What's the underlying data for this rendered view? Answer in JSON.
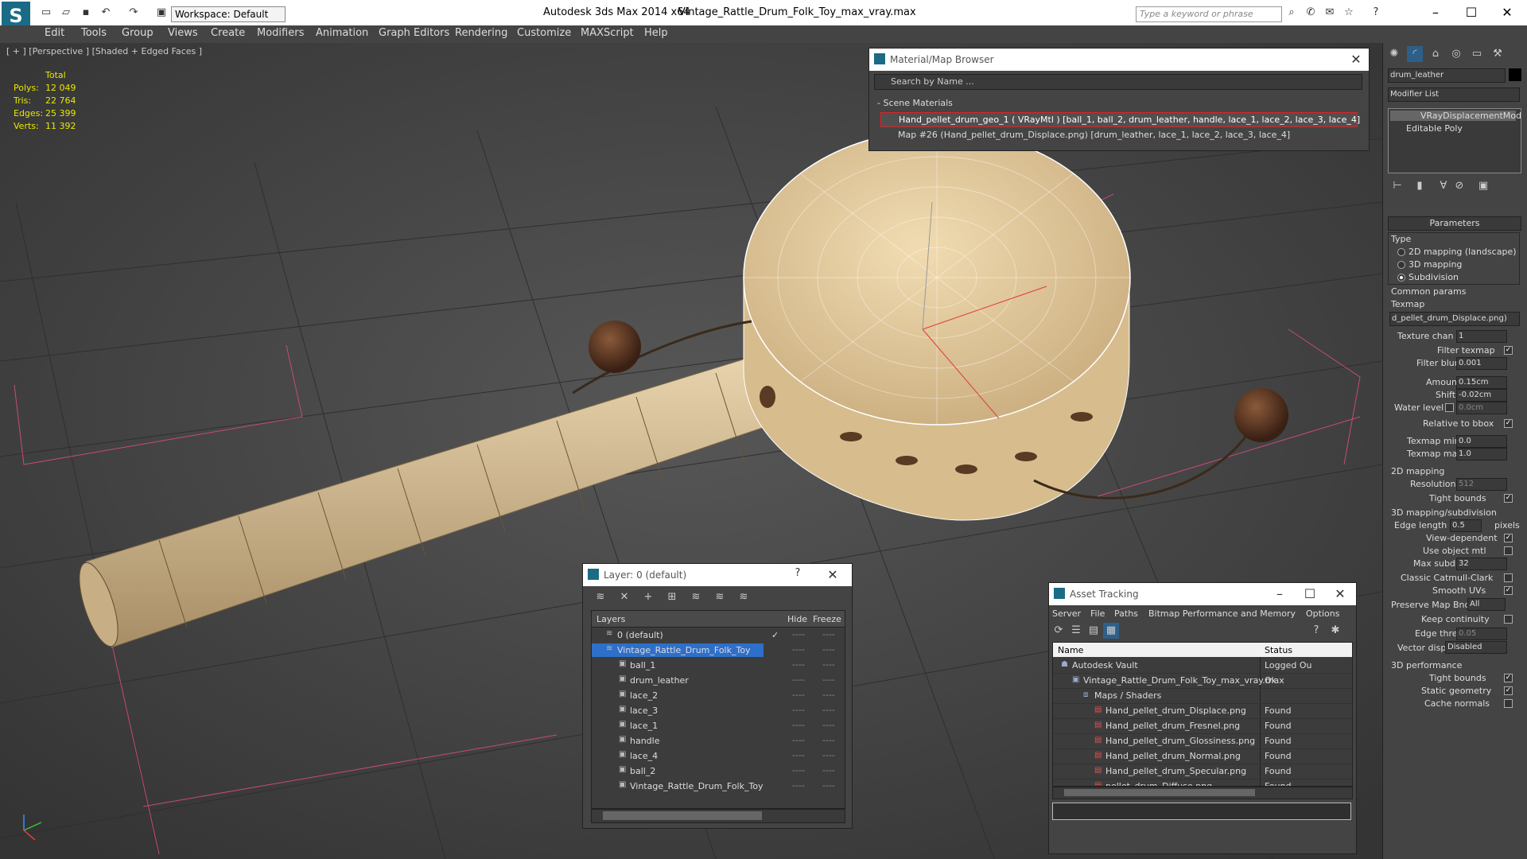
{
  "app": {
    "title": "Autodesk 3ds Max  2014 x64",
    "file": "Vintage_Rattle_Drum_Folk_Toy_max_vray.max",
    "workspace": "Workspace: Default",
    "search_placeholder": "Type a keyword or phrase"
  },
  "menu": [
    "Edit",
    "Tools",
    "Group",
    "Views",
    "Create",
    "Modifiers",
    "Animation",
    "Graph Editors",
    "Rendering",
    "Customize",
    "MAXScript",
    "Help"
  ],
  "viewport": {
    "label": "[ + ] [Perspective ] [Shaded + Edged Faces ]",
    "stats": {
      "header": "Total",
      "rows": [
        {
          "label": "Polys:",
          "value": "12 049"
        },
        {
          "label": "Tris:",
          "value": "22 764"
        },
        {
          "label": "Edges:",
          "value": "25 399"
        },
        {
          "label": "Verts:",
          "value": "11 392"
        }
      ]
    }
  },
  "material_browser": {
    "title": "Material/Map Browser",
    "search_placeholder": "Search by Name ...",
    "section": "- Scene Materials",
    "items": [
      "Hand_pellet_drum_geo_1  ( VRayMtl ) [ball_1, ball_2, drum_leather, handle, lace_1, lace_2, lace_3, lace_4]",
      "Map #26 (Hand_pellet_drum_Displace.png) [drum_leather, lace_1, lace_2, lace_3, lace_4]"
    ]
  },
  "layers": {
    "title": "Layer: 0 (default)",
    "help": "?",
    "columns": {
      "name": "Layers",
      "hide": "Hide",
      "freeze": "Freeze"
    },
    "rows": [
      {
        "name": "0 (default)",
        "level": 0,
        "check": "✓",
        "selected": false
      },
      {
        "name": "Vintage_Rattle_Drum_Folk_Toy",
        "level": 0,
        "check": "",
        "selected": true
      },
      {
        "name": "ball_1",
        "level": 1
      },
      {
        "name": "drum_leather",
        "level": 1
      },
      {
        "name": "lace_2",
        "level": 1
      },
      {
        "name": "lace_3",
        "level": 1
      },
      {
        "name": "lace_1",
        "level": 1
      },
      {
        "name": "handle",
        "level": 1
      },
      {
        "name": "lace_4",
        "level": 1
      },
      {
        "name": "ball_2",
        "level": 1
      },
      {
        "name": "Vintage_Rattle_Drum_Folk_Toy",
        "level": 1
      }
    ],
    "dash": "----"
  },
  "asset_tracking": {
    "title": "Asset Tracking",
    "menu": [
      "Server",
      "File",
      "Paths",
      "Bitmap Performance and Memory",
      "Options"
    ],
    "columns": {
      "name": "Name",
      "status": "Status"
    },
    "rows": [
      {
        "name": "Autodesk Vault",
        "status": "Logged Ou",
        "level": 0
      },
      {
        "name": "Vintage_Rattle_Drum_Folk_Toy_max_vray.max",
        "status": "Ok",
        "level": 1
      },
      {
        "name": "Maps / Shaders",
        "status": "",
        "level": 2
      },
      {
        "name": "Hand_pellet_drum_Displace.png",
        "status": "Found",
        "level": 3
      },
      {
        "name": "Hand_pellet_drum_Fresnel.png",
        "status": "Found",
        "level": 3
      },
      {
        "name": "Hand_pellet_drum_Glossiness.png",
        "status": "Found",
        "level": 3
      },
      {
        "name": "Hand_pellet_drum_Normal.png",
        "status": "Found",
        "level": 3
      },
      {
        "name": "Hand_pellet_drum_Specular.png",
        "status": "Found",
        "level": 3
      },
      {
        "name": "pellet_drum_Diffuse.png",
        "status": "Found",
        "level": 3
      }
    ]
  },
  "command_panel": {
    "object_name": "drum_leather",
    "modifier_list": "Modifier List",
    "stack": [
      "VRayDisplacementMod",
      "Editable Poly"
    ],
    "parameters": "Parameters",
    "type_label": "Type",
    "type_options": [
      {
        "label": "2D mapping (landscape)",
        "on": false
      },
      {
        "label": "3D mapping",
        "on": false
      },
      {
        "label": "Subdivision",
        "on": true
      }
    ],
    "common_params": "Common params",
    "texmap_label": "Texmap",
    "texmap_value": "d_pellet_drum_Displace.png)",
    "texture_chan": {
      "label": "Texture chan",
      "value": "1"
    },
    "filter_texmap": "Filter texmap",
    "filter_blur": {
      "label": "Filter blur",
      "value": "0.001"
    },
    "amount": {
      "label": "Amount",
      "value": "0.15cm"
    },
    "shift": {
      "label": "Shift",
      "value": "-0.02cm"
    },
    "water_level": {
      "label": "Water level",
      "value": "0.0cm"
    },
    "relative_bbox": "Relative to bbox",
    "texmap_min": {
      "label": "Texmap min",
      "value": "0.0"
    },
    "texmap_max": {
      "label": "Texmap max",
      "value": "1.0"
    },
    "mapping_2d": "2D mapping",
    "resolution": {
      "label": "Resolution",
      "value": "512"
    },
    "tight_bounds": "Tight bounds",
    "mapping_3d": "3D mapping/subdivision",
    "edge_length": {
      "label": "Edge length",
      "value": "0.5",
      "unit": "pixels"
    },
    "view_dependent": "View-dependent",
    "use_object_mtl": "Use object mtl",
    "max_subdivs": {
      "label": "Max subdivs",
      "value": "32"
    },
    "classic_catmull": "Classic Catmull-Clark",
    "smooth_uvs": "Smooth UVs",
    "preserve_map": {
      "label": "Preserve Map Bnd",
      "value": "All"
    },
    "keep_continuity": "Keep continuity",
    "edge_thresh": {
      "label": "Edge thresh",
      "value": "0.05"
    },
    "vector_displ": {
      "label": "Vector displ",
      "value": "Disabled"
    },
    "perf": "3D performance",
    "perf_tight": "Tight bounds",
    "static_geo": "Static geometry",
    "cache_normals": "Cache normals"
  }
}
